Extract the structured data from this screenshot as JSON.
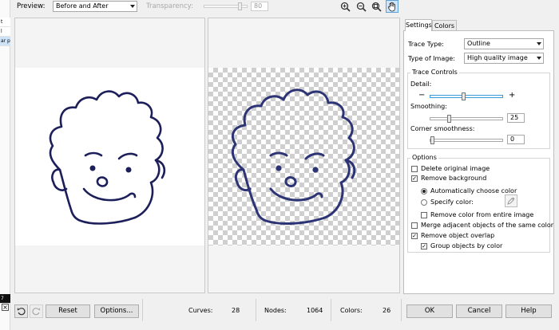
{
  "left_strip": {
    "items": [
      "t",
      "l",
      "ar p"
    ],
    "bottom_item": "7"
  },
  "toolbar": {
    "preview_label": "Preview:",
    "preview_value": "Before and After",
    "transparency_label": "Transparency:",
    "transparency_value": "80",
    "zoom_in_icon": "zoom-in",
    "zoom_out_icon": "zoom-out",
    "zoom_fit_icon": "zoom-fit",
    "pan_icon": "hand"
  },
  "tabs": [
    {
      "label": "Settings"
    },
    {
      "label": "Colors"
    }
  ],
  "settings": {
    "trace_type_label": "Trace Type:",
    "trace_type_value": "Outline",
    "image_type_label": "Type of Image:",
    "image_type_value": "High quality image",
    "trace_controls_label": "Trace Controls",
    "detail_label": "Detail:",
    "detail_minus": "−",
    "detail_plus": "+",
    "detail_level": 0.46,
    "smoothing_label": "Smoothing:",
    "smoothing_value": "25",
    "smoothing_level": 0.25,
    "corner_label": "Corner smoothness:",
    "corner_value": "0",
    "corner_level": 0
  },
  "options": {
    "group_label": "Options",
    "delete_original": {
      "label": "Delete original image",
      "checked": false
    },
    "remove_background": {
      "label": "Remove background",
      "checked": true
    },
    "auto_color": {
      "label": "Automatically choose color",
      "selected": true
    },
    "specify_color": {
      "label": "Specify color:",
      "selected": false
    },
    "remove_entire": {
      "label": "Remove color from entire image",
      "checked": false
    },
    "merge_adjacent": {
      "label": "Merge adjacent objects of the same color",
      "checked": false
    },
    "remove_overlap": {
      "label": "Remove object overlap",
      "checked": true
    },
    "group_by_color": {
      "label": "Group objects by color",
      "checked": true
    }
  },
  "status": {
    "curves_label": "Curves:",
    "curves_value": "28",
    "nodes_label": "Nodes:",
    "nodes_value": "1064",
    "colors_label": "Colors:",
    "colors_value": "26"
  },
  "buttons": {
    "reset": "Reset",
    "options": "Options...",
    "ok": "OK",
    "cancel": "Cancel",
    "help": "Help"
  }
}
